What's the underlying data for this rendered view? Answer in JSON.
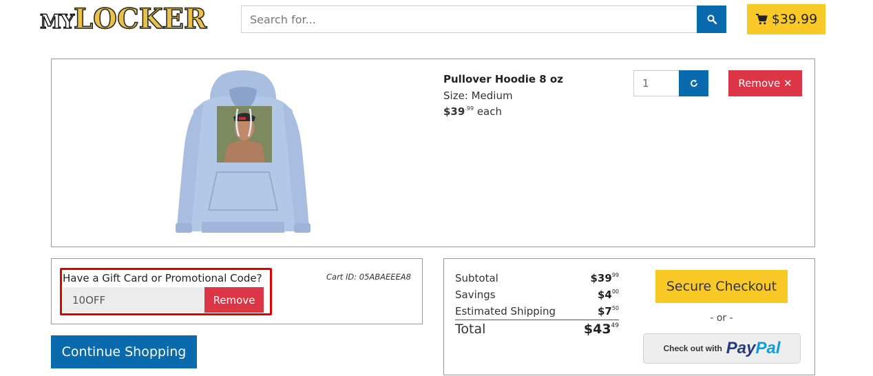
{
  "header": {
    "logo_part1": "MY",
    "logo_part2": "LOCKER",
    "search_placeholder": "Search for...",
    "cart_total": "$39.99"
  },
  "product": {
    "name": "Pullover Hoodie 8 oz",
    "size": "Size: Medium",
    "price_dollars": "$39",
    "price_cents": ".99",
    "price_suffix": "each",
    "quantity": "1",
    "remove_label": "Remove ✕"
  },
  "promo": {
    "label": "Have a Gift Card or Promotional Code?",
    "code": "10OFF",
    "remove_label": "Remove",
    "cart_id": "Cart ID: 05ABAEEEA8"
  },
  "continue_label": "Continue Shopping",
  "summary": {
    "subtotal_label": "Subtotal",
    "subtotal_dollars": "$39",
    "subtotal_cents": "99",
    "savings_label": "Savings",
    "savings_dollars": "$4",
    "savings_cents": "00",
    "shipping_label": "Estimated Shipping",
    "shipping_dollars": "$7",
    "shipping_cents": "50",
    "total_label": "Total",
    "total_dollars": "$43",
    "total_cents": "49"
  },
  "checkout": {
    "secure_label": "Secure Checkout",
    "or_label": "- or -",
    "paypal_prefix": "Check out with",
    "paypal_pay": "Pay",
    "paypal_pal": "Pal"
  },
  "colors": {
    "blue": "#0a6aae",
    "yellow": "#f9c928",
    "red": "#dc3545",
    "hoodie": "#b3c7e6"
  },
  "icons": [
    "search-icon",
    "cart-icon",
    "refresh-icon",
    "close-icon"
  ]
}
